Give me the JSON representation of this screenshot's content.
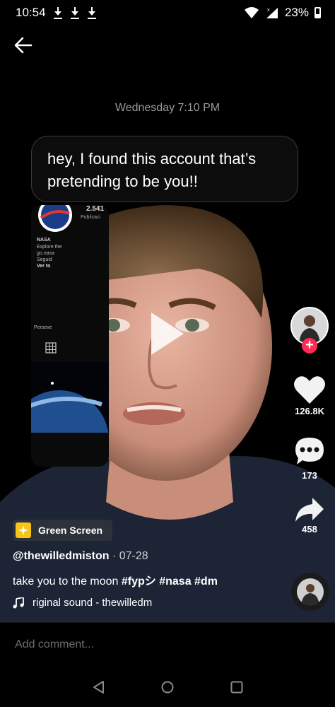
{
  "status_bar": {
    "time": "10:54",
    "battery": "23%"
  },
  "chat": {
    "timestamp": "Wednesday 7:10 PM",
    "message": "hey, I found this account that’s pretending to be you!!"
  },
  "screenshot_text": {
    "name": "NASA",
    "stat": "2.541",
    "stat_label": "Publicaci",
    "bio_1": "Explore the",
    "bio_2": "go.nasa",
    "bio_3": "Seguid",
    "bio_4": "Ver to",
    "story": "Perseve"
  },
  "right_rail": {
    "likes": "126.8K",
    "comments": "173",
    "shares": "458"
  },
  "effect": {
    "label": "Green Screen"
  },
  "post": {
    "username": "@thewilledmiston",
    "date": " · 07-28",
    "caption_text": "take you to the moon ",
    "hashtags": "#fypシ #nasa #dm",
    "sound": "riginal sound - thewilledm"
  },
  "comment": {
    "placeholder": "Add comment..."
  },
  "colors": {
    "follow": "#fe2c55",
    "effect_icon": "#f5c518"
  }
}
